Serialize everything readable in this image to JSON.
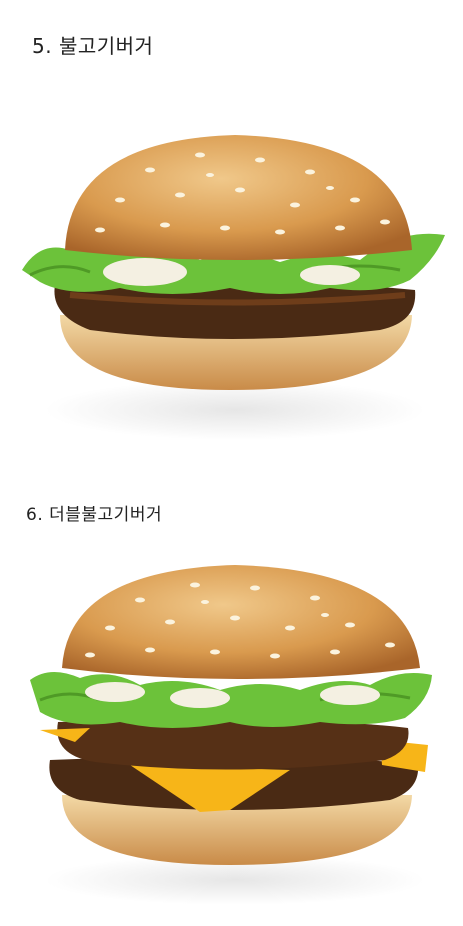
{
  "items": [
    {
      "caption": "5. 불고기버거",
      "image": "bulgogi-burger"
    },
    {
      "caption": "6. 더블불고기버거",
      "image": "double-bulgogi-burger"
    }
  ],
  "colors": {
    "bun": "#d99a4e",
    "bun_highlight": "#f0c88a",
    "lettuce": "#6cc23a",
    "patty": "#4a2a14",
    "cheese": "#f7b518",
    "mayo": "#f4f0e2"
  }
}
